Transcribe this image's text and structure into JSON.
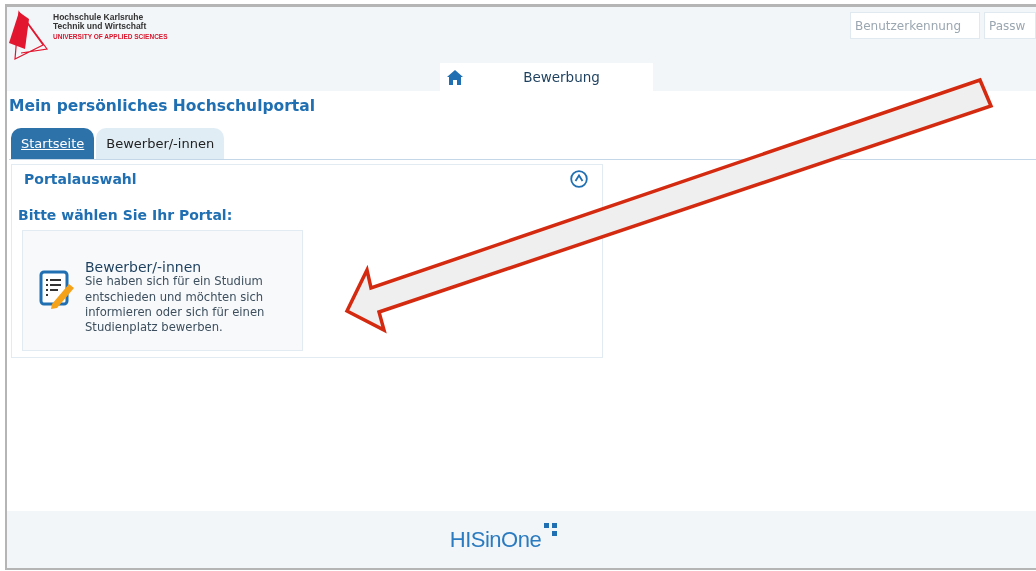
{
  "header": {
    "logo": {
      "line_1": "Hochschule Karlsruhe",
      "line_2": "Technik und Wirtschaft",
      "line_3": "UNIVERSITY OF APPLIED SCIENCES"
    },
    "login": [
      {
        "placeholder": "Benutzerkennung"
      },
      {
        "placeholder": "Passw"
      }
    ]
  },
  "nav": [
    {
      "kind": "home"
    },
    {
      "kind": "text",
      "label": "Bewerbung"
    }
  ],
  "page_title": "Mein persönliches Hochschulportal",
  "tabs": [
    {
      "label": "Startseite",
      "selected": true
    },
    {
      "label": "Bewerber/-innen",
      "selected": false
    }
  ],
  "panel": {
    "title": "Portalauswahl",
    "expanded": true,
    "prompt": "Bitte wählen Sie Ihr Portal:",
    "portals": [
      {
        "title": "Bewerber/-innen",
        "description": "Sie haben sich für ein Studium entschieden und möchten sich informieren oder sich für einen Studienplatz bewerben."
      }
    ]
  },
  "footer": {
    "brand": "HISinOne"
  }
}
